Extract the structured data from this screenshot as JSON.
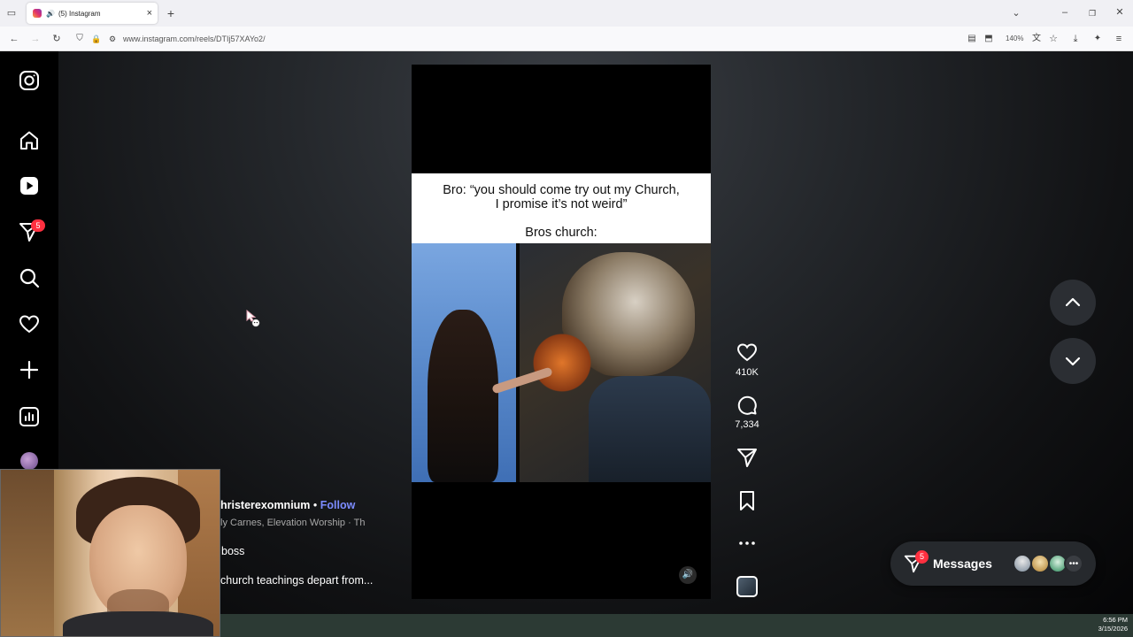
{
  "browser": {
    "tab_title": "(5) Instagram",
    "url": "www.instagram.com/reels/DTIj57XAYo2/",
    "zoom": "140%"
  },
  "sidebar": {
    "items": [
      {
        "icon": "instagram-logo-icon"
      },
      {
        "icon": "home-icon"
      },
      {
        "icon": "reels-icon"
      },
      {
        "icon": "messages-icon",
        "badge": "5"
      },
      {
        "icon": "search-icon"
      },
      {
        "icon": "notifications-heart-icon"
      },
      {
        "icon": "create-plus-icon"
      },
      {
        "icon": "dashboard-icon"
      },
      {
        "icon": "profile-avatar-icon"
      }
    ]
  },
  "reel": {
    "caption_line1": "Bro: “you should come try out my Church,",
    "caption_line2": "I promise it’s not weird”",
    "caption_line3": "Bros church:",
    "username": "hristerexomnium",
    "follow_sep": "•",
    "follow_label": "Follow",
    "audio": "ly Carnes, Elevation Worship · Th",
    "text_short": "boss",
    "description": "church teachings depart from..."
  },
  "actions": {
    "likes": "410K",
    "comments": "7,334"
  },
  "messages": {
    "label": "Messages",
    "badge": "5"
  },
  "taskbar": {
    "time": "6:56 PM",
    "date": "3/15/2026"
  },
  "colors": {
    "accent_blue": "#4a5df9",
    "badge_red": "#ff3040"
  }
}
